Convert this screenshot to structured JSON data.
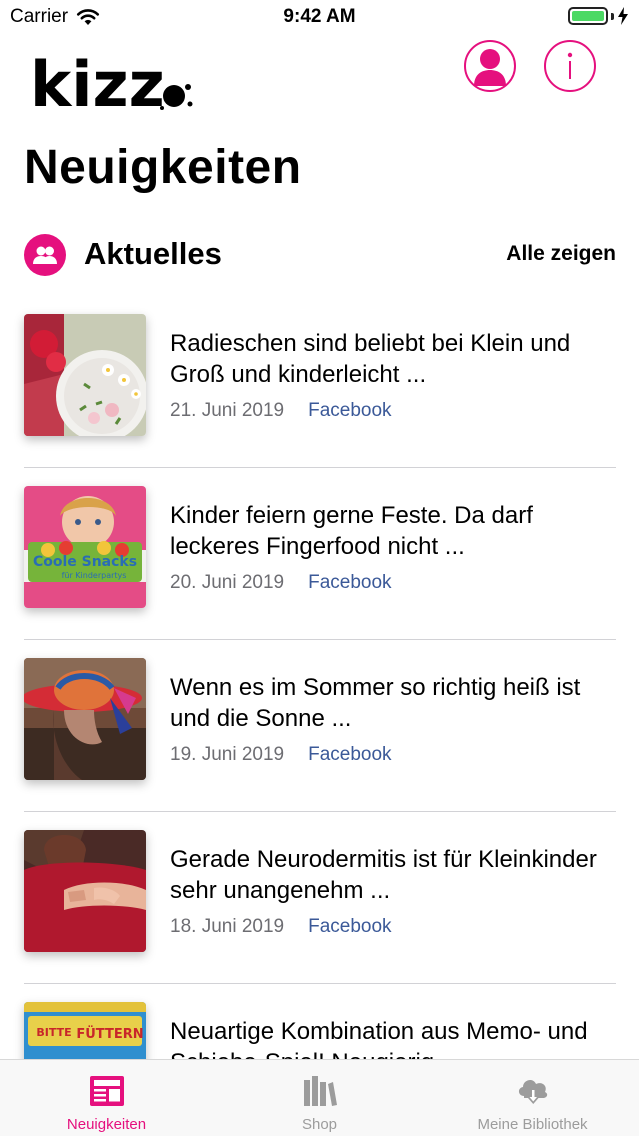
{
  "status_bar": {
    "carrier": "Carrier",
    "time": "9:42 AM",
    "battery_level": 1.0
  },
  "header": {
    "logo_text": "kizz",
    "profile_icon": "person-icon",
    "info_icon": "info-icon"
  },
  "page": {
    "title": "Neuigkeiten"
  },
  "section": {
    "icon": "group-icon",
    "title": "Aktuelles",
    "show_all_label": "Alle zeigen"
  },
  "news": [
    {
      "title": "Radieschen sind beliebt bei Klein und Groß und kinderleicht ...",
      "date": "21. Juni 2019",
      "source": "Facebook"
    },
    {
      "title": "Kinder feiern gerne Feste. Da darf leckeres Fingerfood nicht ...",
      "date": "20. Juni 2019",
      "source": "Facebook",
      "thumb_text_1": "Coole Snacks",
      "thumb_text_2": "für Kinderpartys"
    },
    {
      "title": "Wenn es im Sommer so richtig heiß ist und die Sonne ...",
      "date": "19. Juni 2019",
      "source": "Facebook"
    },
    {
      "title": "Gerade Neurodermitis ist für Kleinkinder sehr unangenehm ...",
      "date": "18. Juni 2019",
      "source": "Facebook"
    },
    {
      "title": "Neuartige Kombination aus Memo- und Schiebe-Spiel! Neugierig ...",
      "date": "",
      "source": "",
      "thumb_text_1": "BITTE",
      "thumb_text_2": "FÜTTERN"
    }
  ],
  "tabs": [
    {
      "label": "Neuigkeiten",
      "icon": "newspaper-icon",
      "active": true
    },
    {
      "label": "Shop",
      "icon": "books-icon",
      "active": false
    },
    {
      "label": "Meine Bibliothek",
      "icon": "cloud-download-icon",
      "active": false
    }
  ],
  "colors": {
    "accent": "#e5107e",
    "link": "#3b5998",
    "muted": "#6d6d72",
    "battery": "#4cd964"
  }
}
